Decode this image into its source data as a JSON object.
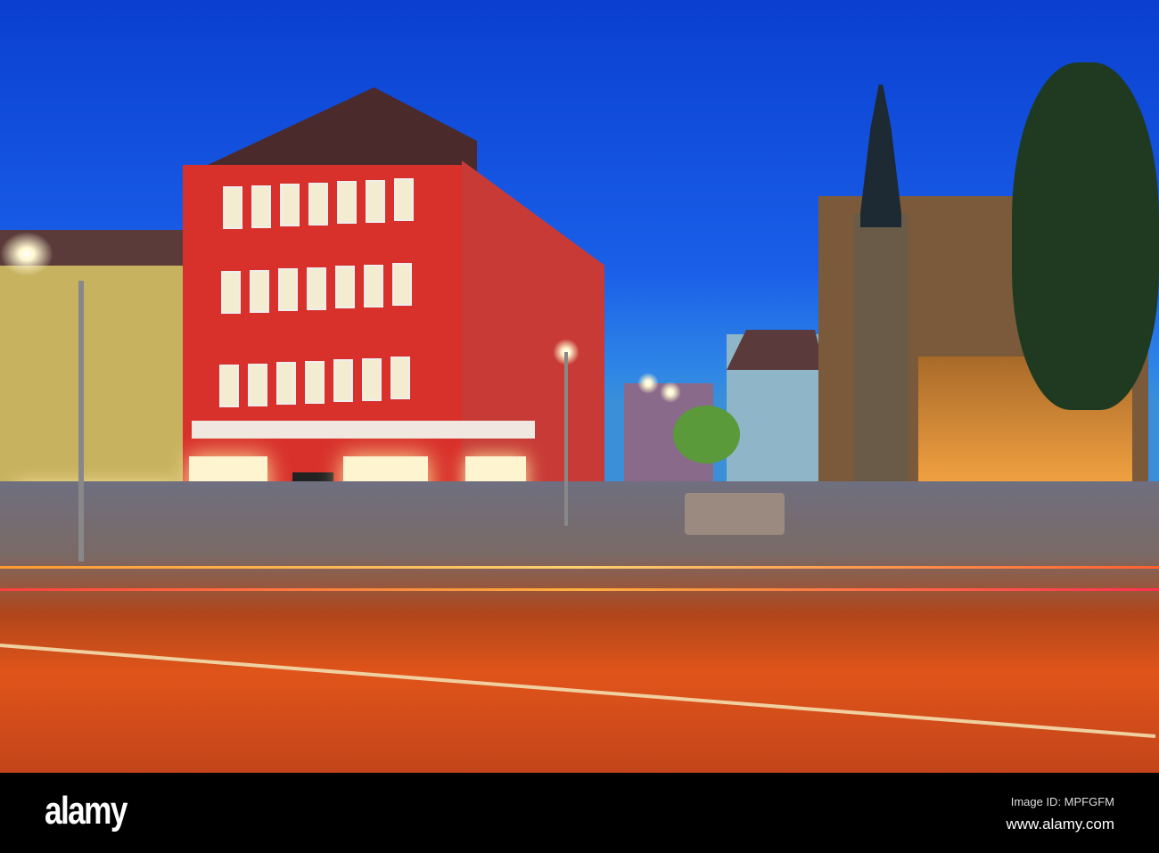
{
  "photo": {
    "subject": "town square at dusk",
    "sky_color": "#1a5fe8",
    "red_building_color": "#d8302a"
  },
  "watermark": {
    "logo": "alamy",
    "image_id": "Image ID: MPFGFM",
    "website": "www.alamy.com"
  }
}
